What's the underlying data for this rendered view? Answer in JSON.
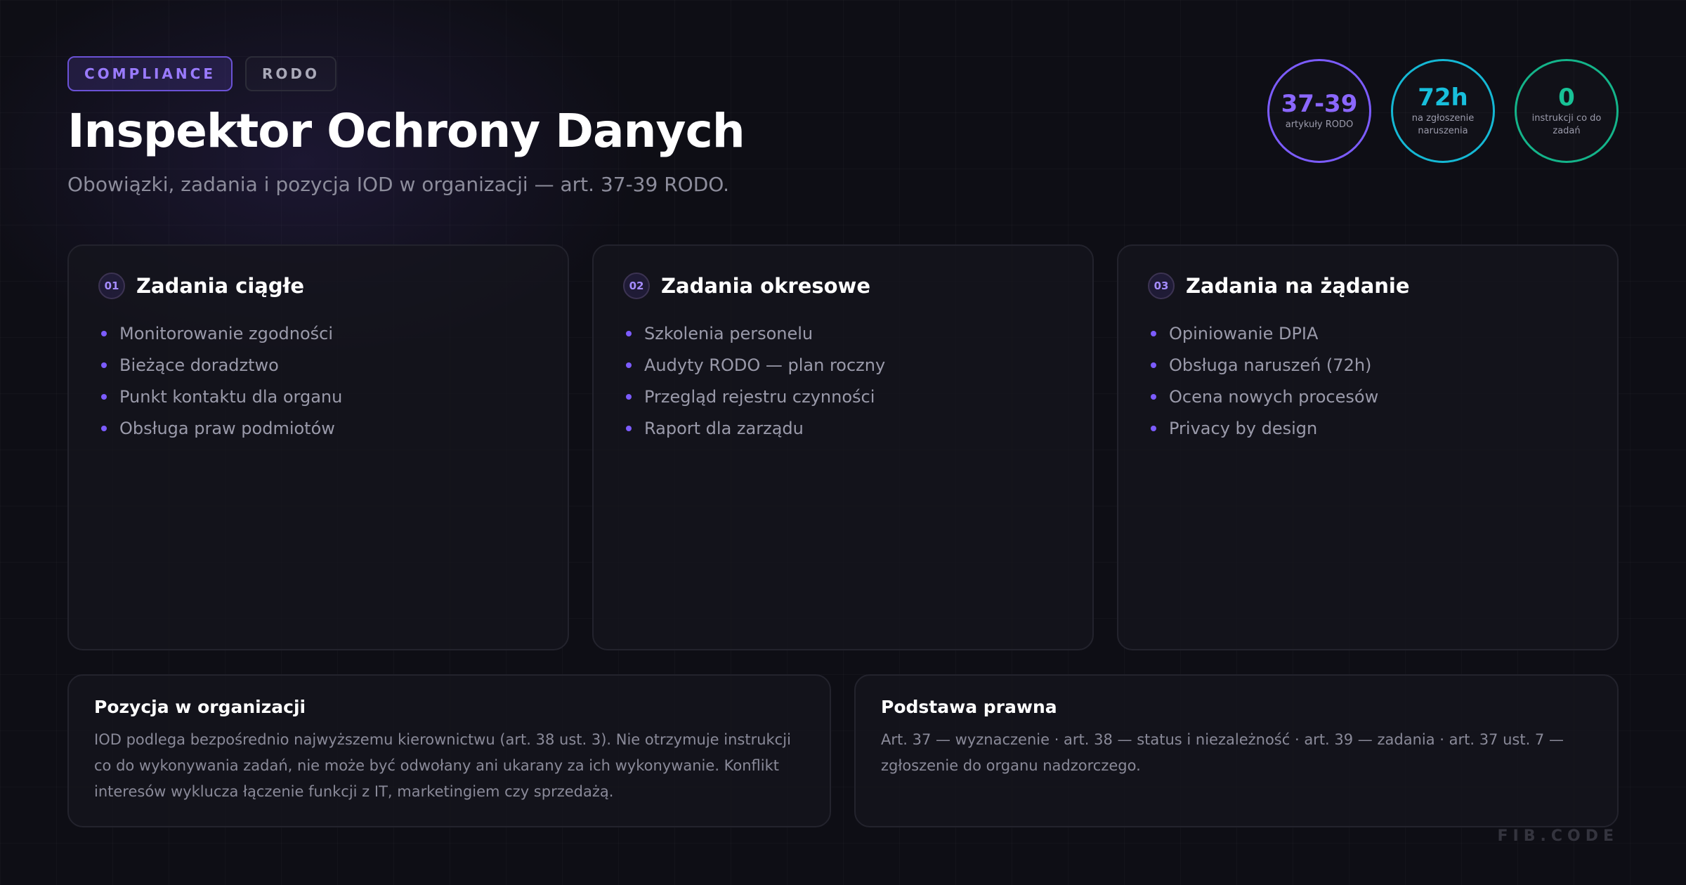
{
  "tags": {
    "primary": "COMPLIANCE",
    "secondary": "RODO"
  },
  "title": "Inspektor Ochrony Danych",
  "subtitle": "Obowiązki, zadania i pozycja IOD w organizacji — art. 37-39 RODO.",
  "stats": [
    {
      "value": "37-39",
      "label": "artykuły RODO",
      "color": "#7c5cff"
    },
    {
      "value": "72h",
      "label": "na zgłoszenie naruszenia",
      "color": "#15b8d4"
    },
    {
      "value": "0",
      "label": "instrukcji co do zadań",
      "color": "#14b48a"
    }
  ],
  "cards": [
    {
      "num": "01",
      "title": "Zadania ciągłe",
      "items": [
        "Monitorowanie zgodności",
        "Bieżące doradztwo",
        "Punkt kontaktu dla organu",
        "Obsługa praw podmiotów"
      ]
    },
    {
      "num": "02",
      "title": "Zadania okresowe",
      "items": [
        "Szkolenia personelu",
        "Audyty RODO — plan roczny",
        "Przegląd rejestru czynności",
        "Raport dla zarządu"
      ]
    },
    {
      "num": "03",
      "title": "Zadania na żądanie",
      "items": [
        "Opiniowanie DPIA",
        "Obsługa naruszeń (72h)",
        "Ocena nowych procesów",
        "Privacy by design"
      ]
    }
  ],
  "position": {
    "title": "Pozycja w organizacji",
    "text": "IOD podlega bezpośrednio najwyższemu kierownictwu (art. 38 ust. 3). Nie otrzymuje instrukcji co do wykonywania zadań, nie może być odwołany ani ukarany za ich wykonywanie. Konflikt interesów wyklucza łączenie funkcji z IT, marketingiem czy sprzedażą."
  },
  "legal": {
    "title": "Podstawa prawna",
    "text": "Art. 37 — wyznaczenie · art. 38 — status i niezależność · art. 39 — zadania · art. 37 ust. 7 — zgłoszenie do organu nadzorczego."
  },
  "brand": "FIB.CODE"
}
